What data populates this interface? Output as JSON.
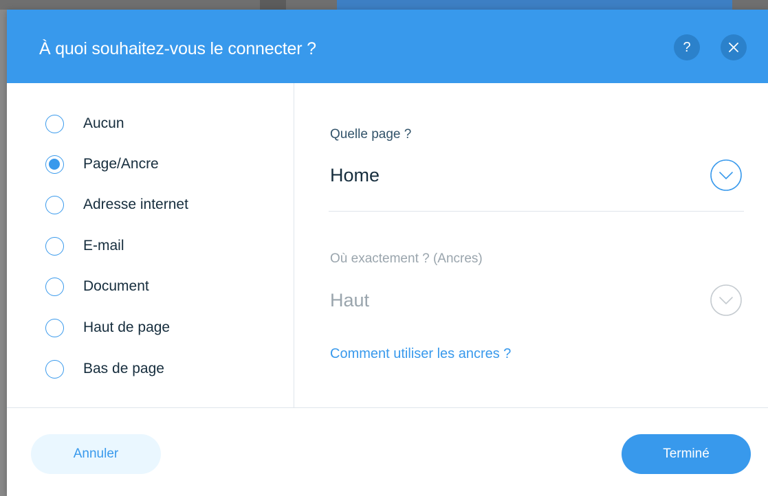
{
  "dialog": {
    "title": "À quoi souhaitez-vous le connecter ?",
    "help_label": "?",
    "close_icon": "close-icon"
  },
  "link_types": [
    {
      "label": "Aucun",
      "selected": false
    },
    {
      "label": "Page/Ancre",
      "selected": true
    },
    {
      "label": "Adresse internet",
      "selected": false
    },
    {
      "label": "E-mail",
      "selected": false
    },
    {
      "label": "Document",
      "selected": false
    },
    {
      "label": "Haut de page",
      "selected": false
    },
    {
      "label": "Bas de page",
      "selected": false
    }
  ],
  "page_select": {
    "label": "Quelle page ?",
    "value": "Home"
  },
  "anchor_select": {
    "label": "Où exactement ? (Ancres)",
    "value": "Haut",
    "disabled": true
  },
  "anchors_help_link": "Comment utiliser les ancres ?",
  "footer": {
    "cancel_label": "Annuler",
    "done_label": "Terminé"
  },
  "colors": {
    "accent": "#3899ec",
    "header_button": "#2b81cb",
    "text_dark": "#162d3d",
    "text_muted": "#9aa5ad"
  }
}
